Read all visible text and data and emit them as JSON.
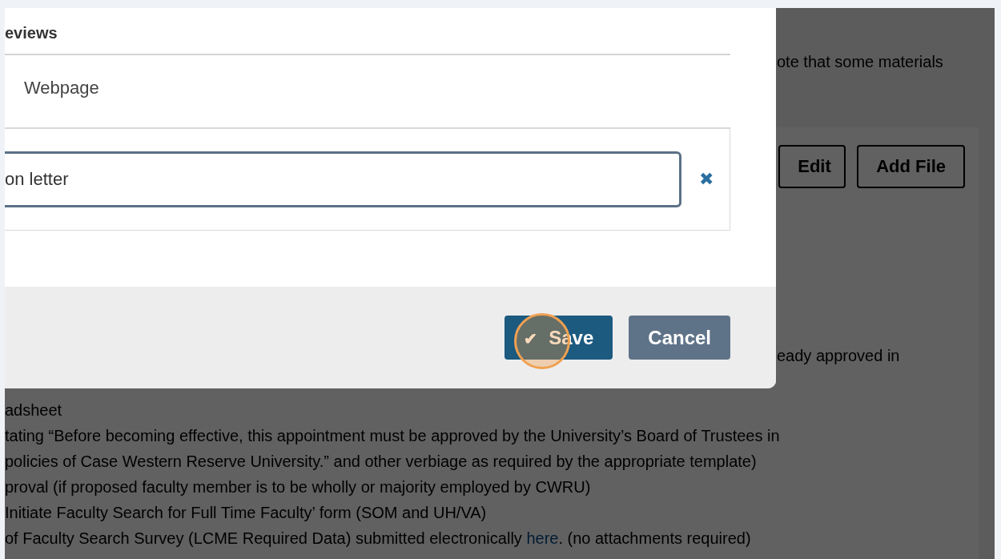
{
  "background_page": {
    "note": "ote that some materials",
    "card": {
      "buttons": [
        {
          "label": "Edit"
        },
        {
          "label": "Add File"
        }
      ],
      "text": "eady approved in",
      "lines": [
        {
          "text": "adsheet"
        },
        {
          "text": "tating “Before becoming effective, this appointment must be approved by the University’s Board of Trustees in"
        },
        {
          "text": "policies of Case Western Reserve University.” and other verbiage as required by the appropriate template)"
        },
        {
          "text": "proval (if proposed faculty member is to be wholly or majority employed by CWRU)"
        },
        {
          "text": "Initiate Faculty Search for Full Time Faculty’ form (SOM and UH/VA)"
        },
        {
          "text": "of Faculty Search Survey (LCME Required Data) submitted electronically ",
          "link": "here",
          "after": ". (no attachments required)"
        }
      ]
    }
  },
  "dialog": {
    "title": "eviews",
    "type_label": "Webpage",
    "field": {
      "value": "on letter"
    },
    "remove": "✖",
    "buttons": [
      {
        "label": "Save",
        "kind": "primary",
        "icon": "✔"
      },
      {
        "label": "Cancel",
        "kind": "secondary"
      }
    ]
  }
}
